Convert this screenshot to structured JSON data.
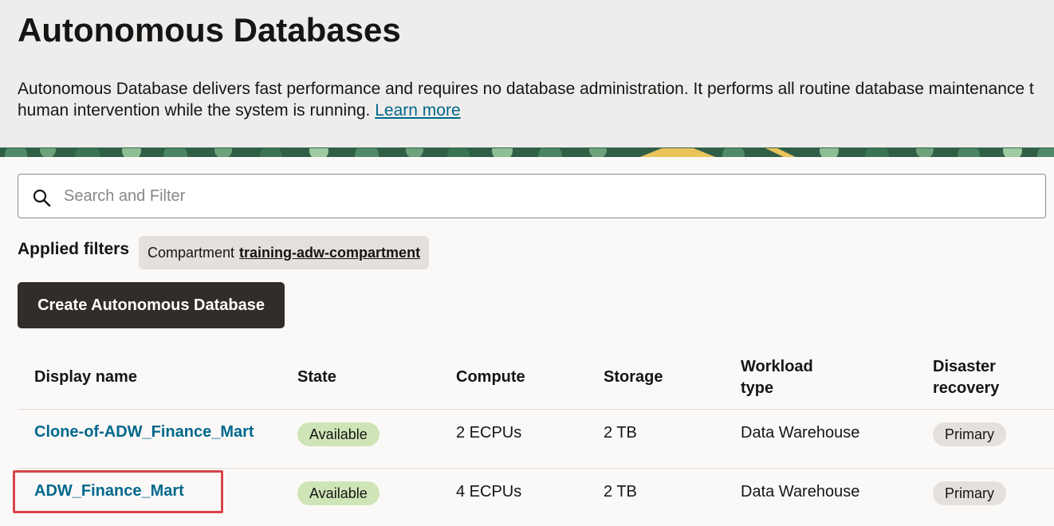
{
  "header": {
    "title": "Autonomous Databases",
    "description_line1": "Autonomous Database delivers fast performance and requires no database administration. It performs all routine database maintenance t",
    "description_line2": "human intervention while the system is running.",
    "learn_more": "Learn more"
  },
  "search": {
    "placeholder": "Search and Filter"
  },
  "filters": {
    "label": "Applied filters",
    "chip_key": "Compartment",
    "chip_value": "training-adw-compartment"
  },
  "actions": {
    "create_label": "Create Autonomous Database"
  },
  "table": {
    "columns": {
      "display_name": "Display name",
      "state": "State",
      "compute": "Compute",
      "storage": "Storage",
      "workload_type_1": "Workload",
      "workload_type_2": "type",
      "disaster_recovery_1": "Disaster",
      "disaster_recovery_2": "recovery"
    },
    "rows": [
      {
        "display_name": "Clone-of-ADW_Finance_Mart",
        "state": "Available",
        "compute": "2 ECPUs",
        "storage": "2 TB",
        "workload_type": "Data Warehouse",
        "disaster_recovery": "Primary"
      },
      {
        "display_name": "ADW_Finance_Mart",
        "state": "Available",
        "compute": "4 ECPUs",
        "storage": "2 TB",
        "workload_type": "Data Warehouse",
        "disaster_recovery": "Primary"
      }
    ]
  },
  "colors": {
    "link": "#00688c",
    "available_badge": "#cfe5b8",
    "primary_badge": "#e4e1dd",
    "button": "#312d2a",
    "highlight": "#d9434a"
  }
}
